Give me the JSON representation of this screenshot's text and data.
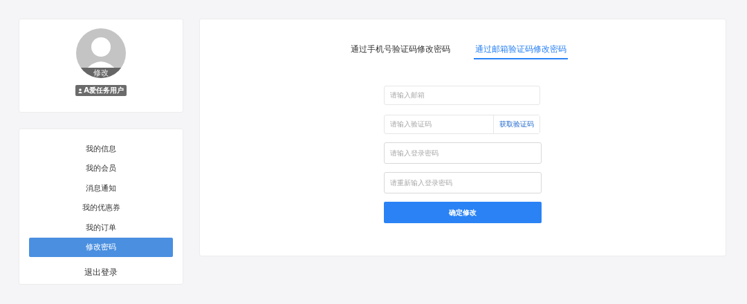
{
  "profile": {
    "avatar_action": "修改",
    "user_badge": "A爱任务用户"
  },
  "menu": [
    {
      "label": "我的信息",
      "selected": false
    },
    {
      "label": "我的会员",
      "selected": false
    },
    {
      "label": "消息通知",
      "selected": false
    },
    {
      "label": "我的优惠券",
      "selected": false
    },
    {
      "label": "我的订单",
      "selected": false
    },
    {
      "label": "修改密码",
      "selected": true
    }
  ],
  "logout": "退出登录",
  "tabs": [
    {
      "label": "通过手机号验证码修改密码",
      "selected": false
    },
    {
      "label": "通过邮箱验证码修改密码",
      "selected": true
    }
  ],
  "form": {
    "fields": [
      {
        "kind": "text",
        "placeholder": "请输入邮箱"
      },
      {
        "kind": "code",
        "placeholder": "请输入验证码",
        "action": "获取验证码"
      },
      {
        "kind": "password",
        "placeholder": "请输入登录密码"
      },
      {
        "kind": "password",
        "placeholder": "请重新输入登录密码"
      }
    ],
    "submit": "确定修改"
  }
}
